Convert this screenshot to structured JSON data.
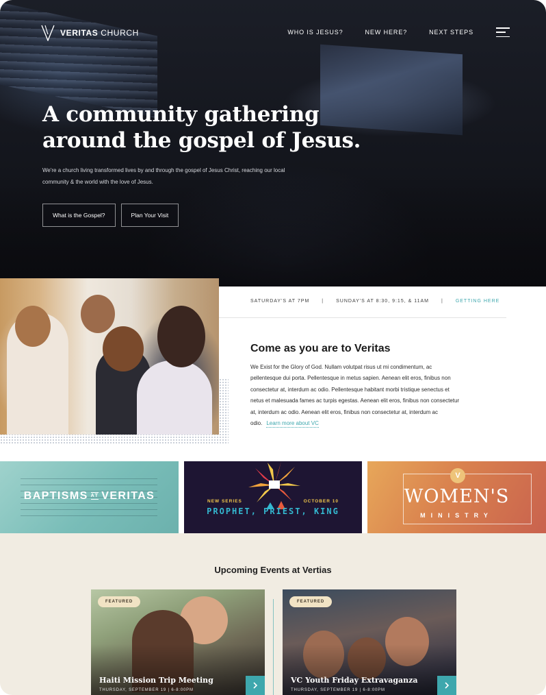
{
  "header": {
    "logo_bold": "VERITAS",
    "logo_light": "CHURCH",
    "nav": [
      {
        "label": "WHO IS JESUS?"
      },
      {
        "label": "NEW HERE?"
      },
      {
        "label": "NEXT STEPS"
      }
    ]
  },
  "hero": {
    "title": "A community gathering around the gospel of Jesus.",
    "subtitle": "We're a church living transformed lives by and through the gospel of Jesus Christ, reaching our local community & the world with the love of Jesus.",
    "buttons": [
      {
        "label": "What is the Gospel?"
      },
      {
        "label": "Plan Your Visit"
      }
    ]
  },
  "service_times": {
    "saturday": "SATURDAY'S AT 7PM",
    "sunday": "SUNDAY'S AT 8:30, 9:15, & 11AM",
    "separator": "|",
    "getting_here": "GETTING HERE"
  },
  "welcome": {
    "title": "Come as you are to Veritas",
    "body": "We Exist for the Glory of God. Nullam volutpat risus ut mi condimentum, ac pellentesque dui porta. Pellentesque in metus sapien. Aenean elit eros, finibus non consectetur at, interdum ac odio. Pellentesque habitant morbi tristique senectus et netus et malesuada fames ac turpis egestas. Aenean elit eros, finibus non consectetur at, interdum ac odio. Aenean elit eros, finibus non consectetur at, interdum ac odio.",
    "link": "Learn more about VC"
  },
  "banners": {
    "baptism": {
      "left": "BAPTISMS",
      "at": "AT",
      "right": "VERITAS"
    },
    "prophet": {
      "series": "NEW SERIES",
      "date": "OCTOBER 10",
      "title": "PROPHET, PRIEST, KING"
    },
    "women": {
      "badge": "V",
      "title": "WOMEN'S",
      "sub": "MINISTRY"
    }
  },
  "events": {
    "title": "Upcoming Events at Vertias",
    "items": [
      {
        "tag": "FEATURED",
        "title": "Haiti Mission Trip Meeting",
        "date": "THURSDAY, SEPTEMBER 19  |  6-8:00PM"
      },
      {
        "tag": "FEATURED",
        "title": "VC Youth Friday Extravaganza",
        "date": "THURSDAY, SEPTEMBER 19  |  6-8:00PM"
      }
    ]
  },
  "colors": {
    "accent": "#3ea7ad",
    "hero_bg": "#14161d",
    "events_bg": "#f1ece2",
    "featured_tag": "#f1e3c4"
  },
  "icons": {
    "logo": "v-logo-icon",
    "menu": "hamburger-menu-icon",
    "arrow": "chevron-right-icon"
  }
}
